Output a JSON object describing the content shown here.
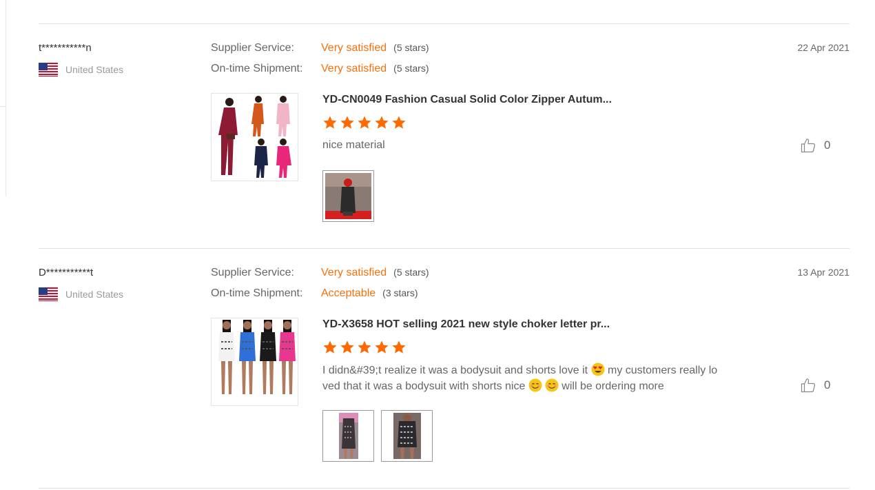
{
  "reviews": [
    {
      "reviewer": "t***********n",
      "country": "United States",
      "flag_icon": "us-flag-icon",
      "supplier_service_label": "Supplier Service:",
      "supplier_service_value": "Very satisfied",
      "supplier_service_stars": "(5 stars)",
      "shipment_label": "On-time Shipment:",
      "shipment_value": "Very satisfied",
      "shipment_stars": "(5 stars)",
      "date": "22 Apr 2021",
      "product_title": "YD-CN0049 Fashion Casual Solid Color Zipper Autum...",
      "product_rating": 5,
      "comment": "nice material",
      "like_count": "0"
    },
    {
      "reviewer": "D***********t",
      "country": "United States",
      "flag_icon": "us-flag-icon",
      "supplier_service_label": "Supplier Service:",
      "supplier_service_value": "Very satisfied",
      "supplier_service_stars": "(5 stars)",
      "shipment_label": "On-time Shipment:",
      "shipment_value": "Acceptable",
      "shipment_stars": "(3 stars)",
      "date": "13 Apr 2021",
      "product_title": "YD-X3658 HOT selling 2021 new style choker letter pr...",
      "product_rating": 5,
      "comment_part1": "I didn&#39;t realize it was a bodysuit and shorts love it",
      "comment_part2": " my customers really lo",
      "comment_part3": "ved that it was a bodysuit with shorts nice",
      "comment_part4": " will be ordering more",
      "like_count": "0"
    }
  ],
  "colors": {
    "accent": "#f7700a",
    "star": "#ff6a00",
    "divider": "#e0e0e0"
  }
}
